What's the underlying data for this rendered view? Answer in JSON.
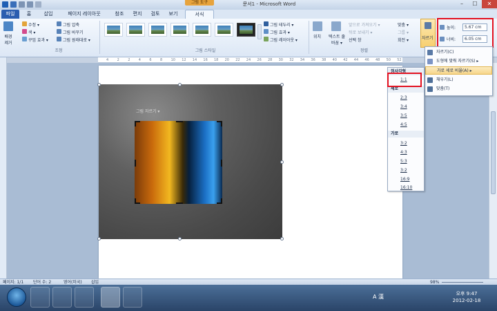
{
  "titlebar": {
    "context_tab": "그림 도구",
    "title": "문서1 - Microsoft Word",
    "controls": {
      "minimize": "–",
      "maximize": "☐",
      "close": "✕"
    }
  },
  "tabs": [
    "파일",
    "홈",
    "삽입",
    "페이지 레이아웃",
    "참조",
    "편지",
    "검토",
    "보기",
    "서식"
  ],
  "ribbon": {
    "remove_bg": "배경 제거",
    "adjust": {
      "items": [
        "수정 ▾",
        "색 ▾",
        "꾸밈 효과 ▾"
      ],
      "items2": [
        "그림 압축",
        "그림 바꾸기",
        "그림 원래대로 ▾"
      ],
      "label": "조정"
    },
    "styles": {
      "border": "그림 테두리 ▾",
      "effects": "그림 효과 ▾",
      "layout": "그림 레이아웃 ▾",
      "label": "그림 스타일"
    },
    "arrange": {
      "position": "위치",
      "wrap": "텍스트 줄 바꿈 ▾",
      "forward": "앞으로 가져오기 ▾",
      "backward": "뒤로 보내기 ▾",
      "pane": "선택 창",
      "align": "맞춤 ▾",
      "group": "그룹 ▾",
      "rotate": "회전 ▾",
      "label": "정렬"
    },
    "crop": "자르기",
    "size": {
      "height_label": "높이:",
      "height_value": "5.67 cm",
      "width_label": "너비:",
      "width_value": "6.05 cm"
    }
  },
  "ruler_numbers": [
    "4",
    "2",
    "2",
    "4",
    "6",
    "8",
    "10",
    "12",
    "14",
    "16",
    "18",
    "20",
    "22",
    "24",
    "26",
    "28",
    "30",
    "32",
    "34",
    "36",
    "38",
    "40",
    "42",
    "44",
    "46",
    "48",
    "50",
    "52"
  ],
  "document": {
    "inline_text": "그림 자르기 ▾"
  },
  "crop_menu": {
    "items": [
      {
        "label": "자르기(C)",
        "icon": "crop-icon"
      },
      {
        "label": "도형에 맞춰 자르기(S) ▸",
        "icon": "shape-icon"
      },
      {
        "label": "가로 세로 비율(A) ▸",
        "icon": "ratio-icon"
      },
      {
        "label": "채우기(L)",
        "icon": "fill-icon"
      },
      {
        "label": "맞춤(T)",
        "icon": "fit-icon"
      }
    ]
  },
  "aspect_menu": {
    "square_header": "정사각형",
    "square": [
      "1:1"
    ],
    "portrait_header": "세로",
    "portrait": [
      "2:3",
      "3:4",
      "3:5",
      "4:5"
    ],
    "landscape_header": "가로",
    "landscape": [
      "3:2",
      "4:3",
      "5:3",
      "3:2",
      "16:9",
      "16:10"
    ]
  },
  "statusbar": {
    "page": "페이지: 1/1",
    "words": "단어 수: 2",
    "lang": "영어(미국)",
    "mode": "삽입",
    "zoom": "98%"
  },
  "taskbar": {
    "ime": "A 漢",
    "time": "오후 9:47",
    "date": "2012-02-18"
  }
}
